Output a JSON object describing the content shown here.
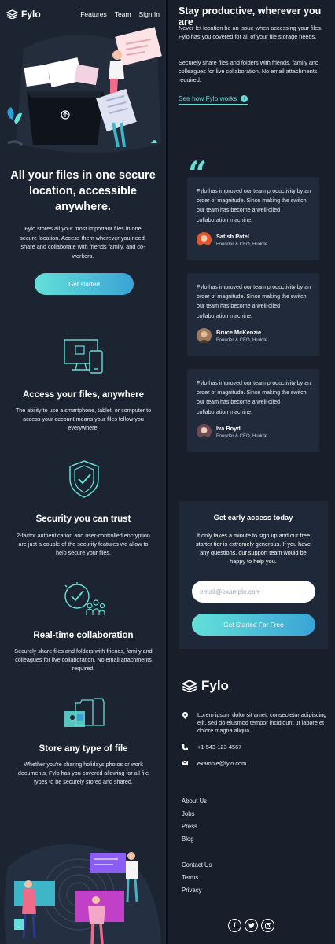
{
  "nav": {
    "logo": "Fylo",
    "links": [
      "Features",
      "Team",
      "Sign In"
    ]
  },
  "hero": {
    "title": "All your files in one secure location, accessible anywhere.",
    "text": "Fylo stores all your most important files in one secure location. Access them wherever you need, share and collaborate with friends family, and co-workers.",
    "cta": "Get started"
  },
  "features": [
    {
      "icon": "devices-icon",
      "title": "Access your files, anywhere",
      "text": "The ability to use a smartphone, tablet, or computer to access your account means your files follow you everywhere."
    },
    {
      "icon": "shield-check-icon",
      "title": "Security you can trust",
      "text": "2-factor authentication and user-controlled encryption are just a couple of the security features we allow to help secure your files."
    },
    {
      "icon": "collaboration-icon",
      "title": "Real-time collaboration",
      "text": "Securely share files and folders with friends, family and colleagues for live collaboration. No email attachments required."
    },
    {
      "icon": "files-icon",
      "title": "Store any type of file",
      "text": "Whether you're sharing holidays photos or work documents, Fylo has you covered allowing for all file types to be securely stored and shared."
    }
  ],
  "productive": {
    "title": "Stay productive, wherever you are",
    "p1": "Never let location be an issue when accessing your files. Fylo has you covered for all of your file storage needs.",
    "p2": "Securely share files and folders with friends, family and colleagues for live collaboration. No email attachments required.",
    "link": "See how Fylo works"
  },
  "testimonials": [
    {
      "text": "Fylo has improved our team productivity by an order of magnitude. Since making the switch our team has become a well-oiled collaboration machine.",
      "name": "Satish Patel",
      "role": "Founder & CEO, Huddle",
      "avatar_color": "#e0552b"
    },
    {
      "text": "Fylo has improved our team productivity by an order of magnitude. Since making the switch our team has become a well-oiled collaboration machine.",
      "name": "Bruce McKenzie",
      "role": "Founder & CEO, Huddle",
      "avatar_color": "#9c7a5b"
    },
    {
      "text": "Fylo has improved our team productivity by an order of magnitude. Since making the switch our team has become a well-oiled collaboration machine.",
      "name": "Iva Boyd",
      "role": "Founder & CEO, Huddle",
      "avatar_color": "#6b4a55"
    }
  ],
  "access": {
    "title": "Get early access today",
    "text": "It only takes a minute to sign up and our free starter tier is extremely generous. If you have any questions, our support team would be happy to help you.",
    "placeholder": "email@example.com",
    "button": "Get Started For Free"
  },
  "footer": {
    "logo": "Fylo",
    "address": "Lorem ipsum dolor sit amet, consectetur adipiscing elit, sed do eiusmod tempor incididunt ut labore et dolore magna aliqua",
    "phone": "+1-543-123-4567",
    "email": "example@fylo.com",
    "links1": [
      "About Us",
      "Jobs",
      "Press",
      "Blog"
    ],
    "links2": [
      "Contact Us",
      "Terms",
      "Privacy"
    ],
    "socials": [
      "facebook-icon",
      "twitter-icon",
      "instagram-icon"
    ]
  },
  "colors": {
    "accent": "#63e0d8",
    "accent2": "#3aa3d6",
    "bg_left": "#1c2431",
    "bg_right": "#181f2a",
    "card": "#202a3a"
  }
}
